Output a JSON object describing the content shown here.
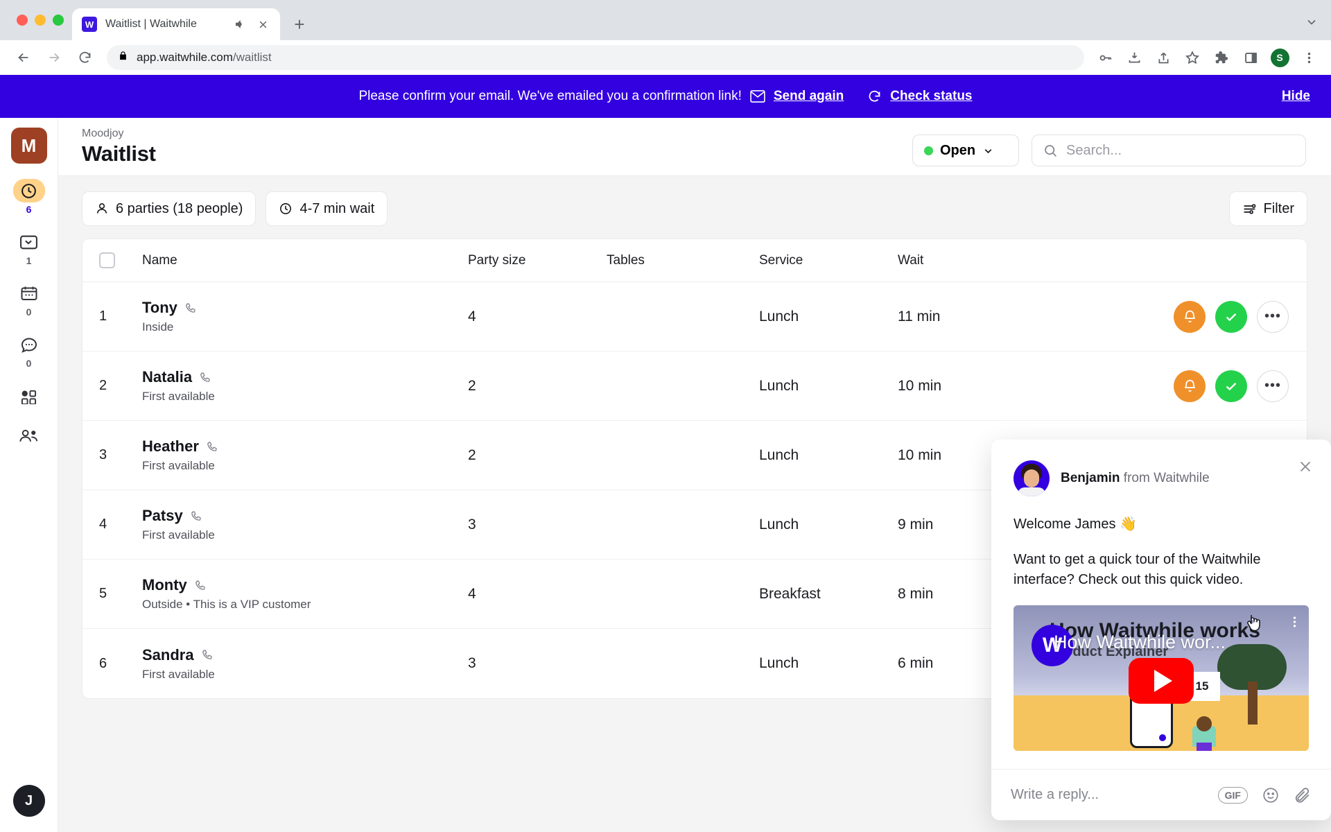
{
  "browser": {
    "tab": {
      "title": "Waitlist | Waitwhile",
      "favicon_letter": "W",
      "audio_icon": "speaker-icon",
      "close_icon": "close-icon"
    },
    "new_tab_label": "+",
    "tablist_chevron": "chevron-down-icon",
    "url": "app.waitwhile.com",
    "url_path": "/waitlist",
    "profile_initial": "S",
    "toolbar_icons": [
      "key-icon",
      "download-icon",
      "share-icon",
      "star-icon",
      "extensions-icon",
      "side-panel-icon",
      "profile-avatar",
      "kebab-menu-icon"
    ]
  },
  "banner": {
    "message": "Please confirm your email. We've emailed you a confirmation link!",
    "send_again": "Send again",
    "check_status": "Check status",
    "hide": "Hide",
    "color": "#3300e0"
  },
  "sidebar": {
    "logo_letter": "M",
    "logo_color": "#9e4024",
    "items": [
      {
        "name": "waitlist",
        "icon": "clock-icon",
        "count": "6",
        "active": true
      },
      {
        "name": "served",
        "icon": "check-inbox-icon",
        "count": "1",
        "active": false
      },
      {
        "name": "bookings",
        "icon": "calendar-icon",
        "count": "0",
        "active": false
      },
      {
        "name": "messages",
        "icon": "chat-bubble-icon",
        "count": "0",
        "active": false
      },
      {
        "name": "apps",
        "icon": "grid-icon",
        "count": "",
        "active": false
      },
      {
        "name": "customers",
        "icon": "people-icon",
        "count": "",
        "active": false
      }
    ],
    "user_initial": "J"
  },
  "header": {
    "breadcrumb": "Moodjoy",
    "title": "Waitlist",
    "status": {
      "label": "Open",
      "dot_color": "#3ad657",
      "chevron": "chevron-down-icon"
    },
    "search": {
      "placeholder": "Search...",
      "value": "",
      "icon": "search-icon"
    }
  },
  "toolbar": {
    "parties_chip": "6 parties (18 people)",
    "parties_icon": "person-icon",
    "wait_chip": "4-7 min wait",
    "wait_icon": "clock-icon",
    "filter_label": "Filter",
    "filter_icon": "sliders-icon"
  },
  "table": {
    "columns": [
      "Name",
      "Party size",
      "Tables",
      "Service",
      "Wait"
    ],
    "rows": [
      {
        "num": "1",
        "name": "Tony",
        "sub": "Inside",
        "party_size": "4",
        "tables": "",
        "service": "Lunch",
        "wait": "11 min"
      },
      {
        "num": "2",
        "name": "Natalia",
        "sub": "First available",
        "party_size": "2",
        "tables": "",
        "service": "Lunch",
        "wait": "10 min"
      },
      {
        "num": "3",
        "name": "Heather",
        "sub": "First available",
        "party_size": "2",
        "tables": "",
        "service": "Lunch",
        "wait": "10 min"
      },
      {
        "num": "4",
        "name": "Patsy",
        "sub": "First available",
        "party_size": "3",
        "tables": "",
        "service": "Lunch",
        "wait": "9 min"
      },
      {
        "num": "5",
        "name": "Monty",
        "sub": "Outside  •  This is a VIP customer",
        "party_size": "4",
        "tables": "",
        "service": "Breakfast",
        "wait": "8 min"
      },
      {
        "num": "6",
        "name": "Sandra",
        "sub": "First available",
        "party_size": "3",
        "tables": "",
        "service": "Lunch",
        "wait": "6 min"
      }
    ],
    "row_actions": {
      "notify_icon": "bell-icon",
      "serve_icon": "check-icon",
      "more_icon": "ellipsis-icon",
      "notify_color": "#f0902a",
      "serve_color": "#24d14a"
    }
  },
  "intercom": {
    "sender_name": "Benjamin",
    "sender_suffix": " from Waitwhile",
    "close_icon": "close-icon",
    "message_1": "Welcome James 👋",
    "message_2": "Want to get a quick tour of the Waitwhile interface? Check out this quick video.",
    "video": {
      "title": "How Waitwhile works",
      "subtitle": "Product Explainer",
      "overlay_title": "How Waitwhile wor...",
      "logo_letter": "W",
      "badge": "15",
      "play_icon": "youtube-play-icon",
      "kebab_icon": "kebab-menu-icon"
    },
    "reply_placeholder": "Write a reply...",
    "reply_icons": [
      "gif-button",
      "emoji-icon",
      "attachment-icon"
    ],
    "gif_label": "GIF"
  }
}
